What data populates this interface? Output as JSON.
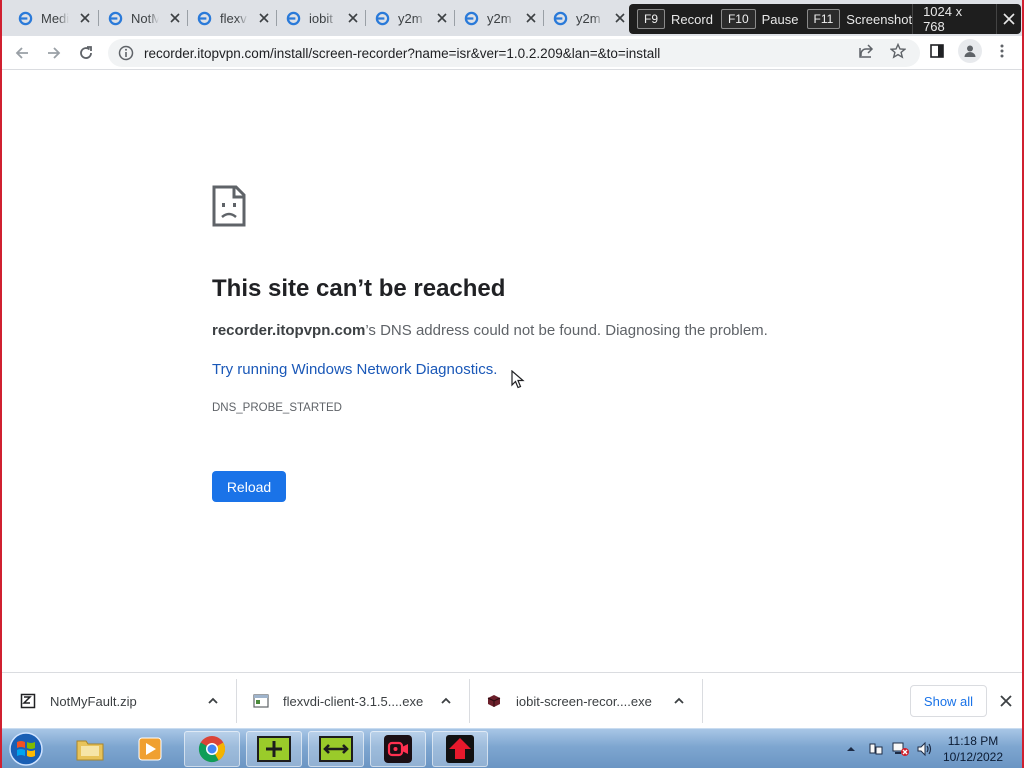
{
  "tabs": [
    {
      "label": "Medi"
    },
    {
      "label": "NotM"
    },
    {
      "label": "flexv"
    },
    {
      "label": "iobit"
    },
    {
      "label": "y2m"
    },
    {
      "label": "y2m"
    },
    {
      "label": "y2m"
    }
  ],
  "recorder": {
    "record_key": "F9",
    "record_label": "Record",
    "pause_key": "F10",
    "pause_label": "Pause",
    "screenshot_key": "F11",
    "screenshot_label": "Screenshot",
    "resolution": "1024 x 768"
  },
  "address": {
    "url": "recorder.itopvpn.com/install/screen-recorder?name=isr&ver=1.0.2.209&lan=&to=install"
  },
  "error": {
    "title": "This site can’t be reached",
    "host": "recorder.itopvpn.com",
    "message_rest": "’s DNS address could not be found. Diagnosing the problem.",
    "link": "Try running Windows Network Diagnostics.",
    "code": "DNS_PROBE_STARTED",
    "reload_label": "Reload"
  },
  "downloads": {
    "items": [
      {
        "name": "NotMyFault.zip",
        "icon": "zip-file-icon"
      },
      {
        "name": "flexvdi-client-3.1.5....exe",
        "icon": "installer-file-icon"
      },
      {
        "name": "iobit-screen-recor....exe",
        "icon": "app-file-icon"
      }
    ],
    "show_all_label": "Show all"
  },
  "taskbar": {
    "time": "11:18 PM",
    "date": "10/12/2022"
  },
  "colors": {
    "accent": "#1a73e8",
    "link": "#1a58b8",
    "frame": "#d02030"
  }
}
